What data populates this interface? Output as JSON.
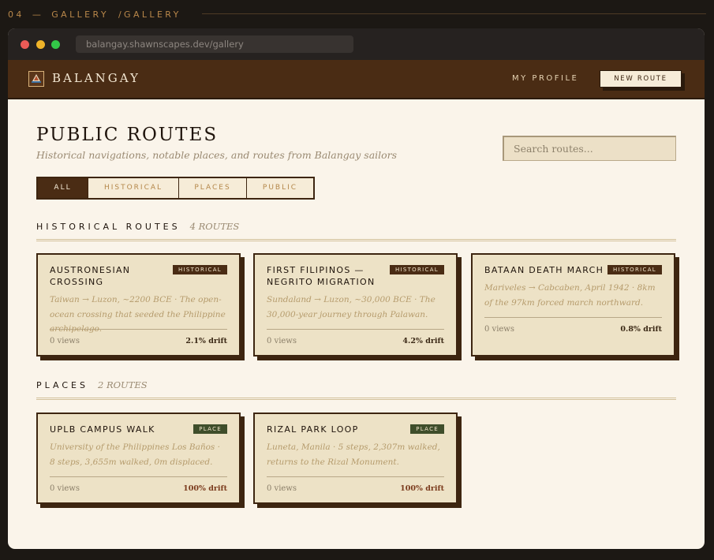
{
  "caption": {
    "number": "04",
    "dash": "—",
    "section": "GALLERY",
    "path": "/GALLERY"
  },
  "browser": {
    "url": "balangay.shawnscapes.dev/gallery"
  },
  "header": {
    "brand": "BALANGAY",
    "profile_label": "MY PROFILE",
    "new_route_label": "NEW ROUTE"
  },
  "page": {
    "title": "PUBLIC ROUTES",
    "subtitle": "Historical navigations, notable places, and routes from Balangay sailors",
    "search_placeholder": "Search routes..."
  },
  "filters": [
    {
      "label": "ALL",
      "active": true
    },
    {
      "label": "HISTORICAL",
      "active": false
    },
    {
      "label": "PLACES",
      "active": false
    },
    {
      "label": "PUBLIC",
      "active": false
    }
  ],
  "sections": {
    "historical": {
      "title": "HISTORICAL ROUTES",
      "count": "4 ROUTES",
      "cards": [
        {
          "title": "AUSTRONESIAN CROSSING",
          "tag": "HISTORICAL",
          "desc": "Taiwan → Luzon, ~2200 BCE · The open-ocean crossing that seeded the Philippine archipelago.",
          "views": "0 views",
          "drift": "2.1% drift"
        },
        {
          "title": "FIRST FILIPINOS — NEGRITO MIGRATION",
          "tag": "HISTORICAL",
          "desc": "Sundaland → Luzon, ~30,000 BCE · The 30,000-year journey through Palawan.",
          "views": "0 views",
          "drift": "4.2% drift"
        },
        {
          "title": "BATAAN DEATH MARCH",
          "tag": "HISTORICAL",
          "desc": "Mariveles → Cabcaben, April 1942 · 8km of the 97km forced march northward.",
          "views": "0 views",
          "drift": "0.8% drift"
        }
      ]
    },
    "places": {
      "title": "PLACES",
      "count": "2 ROUTES",
      "cards": [
        {
          "title": "UPLB CAMPUS WALK",
          "tag": "PLACE",
          "desc": "University of the Philippines Los Baños · 8 steps, 3,655m walked, 0m displaced.",
          "views": "0 views",
          "drift": "100% drift"
        },
        {
          "title": "RIZAL PARK LOOP",
          "tag": "PLACE",
          "desc": "Luneta, Manila · 5 steps, 2,307m walked, returns to the Rizal Monument.",
          "views": "0 views",
          "drift": "100% drift"
        }
      ]
    }
  },
  "colors": {
    "accent": "#4a2c14",
    "place_tag": "#3f4e2b",
    "background": "#faf4ea",
    "card": "#ede2c6"
  }
}
